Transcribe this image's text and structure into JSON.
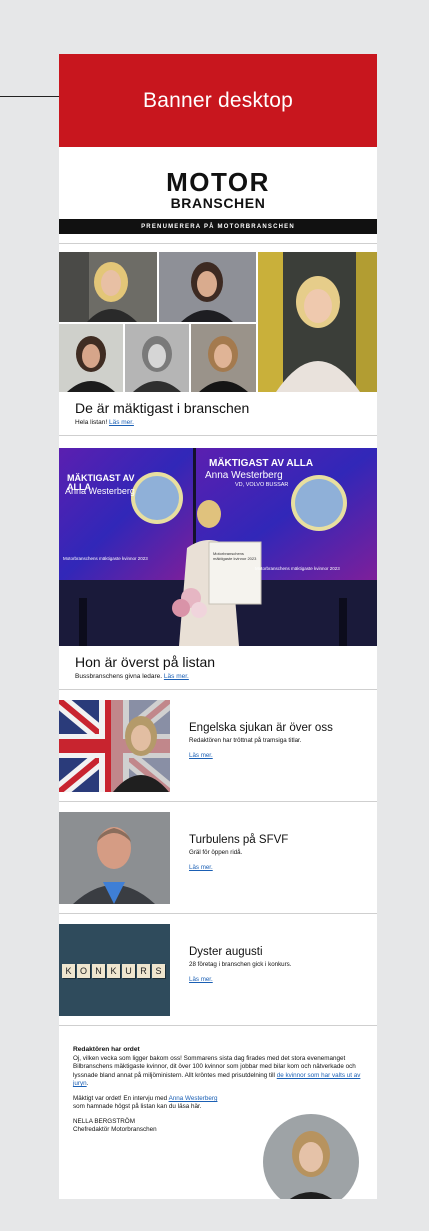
{
  "banner": {
    "label": "Banner desktop"
  },
  "masthead": {
    "logo_line1": "MOTOR",
    "logo_line2": "BRANSCHEN",
    "subscribe": "PRENUMERERA PÅ MOTORBRANSCHEN"
  },
  "feature1": {
    "headline": "De är mäktigast i branschen",
    "dek": "Hela listan!",
    "link": "Läs mer."
  },
  "feature2": {
    "screen_title": "MÄKTIGAST AV ALLA",
    "screen_name": "Anna Westerberg",
    "screen_company": "VD, VOLVO BUSSAR",
    "screen_footer_left": "Motorbranschens mäktigaste kvinnor 2023",
    "screen_footer_right": "Motorbranschens mäktigaste kvinnor 2023",
    "diploma_text": "Motorbranschens mäktigaste kvinnor 2023",
    "headline": "Hon är överst på listan",
    "dek": "Bussbranschens givna ledare.",
    "link": "Läs mer."
  },
  "articles": [
    {
      "headline": "Engelska sjukan är över oss",
      "dek": "Redaktören har tröttnat på tramsiga titlar.",
      "link": "Läs mer."
    },
    {
      "headline": "Turbulens på SFVF",
      "dek": "Gräl för öppen ridå.",
      "link": "Läs mer."
    },
    {
      "headline": "Dyster augusti",
      "dek": "28 företag i branschen gick i konkurs.",
      "link": "Läs mer.",
      "tiles": [
        "K",
        "O",
        "N",
        "K",
        "U",
        "R",
        "S"
      ]
    }
  ],
  "editor": {
    "title": "Redaktören har ordet",
    "p1": "Oj, vilken vecka som ligger bakom oss! Sommarens sista dag firades med det stora evenemanget Bilbranschens mäktigaste kvinnor, dit över 100 kvinnor som jobbar med bilar kom och nätverkade och lyssnade bland annat på miljöministern. Allt kröntes med prisutdelning till",
    "p1_link": "de kvinnor som har valts ut av juryn",
    "p1_end": ".",
    "p2": "Mäktigt var ordet! En intervju med",
    "p2_link": "Anna Westerberg",
    "p2_end": "som hamnade högst på listan kan du läsa här.",
    "signature_name": "NELLA BERGSTRÖM",
    "signature_role": "Chefredaktör Motorbranschen"
  },
  "colors": {
    "banner": "#c8161e",
    "link": "#1a5fb4",
    "page_bg": "#e6e7e8"
  }
}
